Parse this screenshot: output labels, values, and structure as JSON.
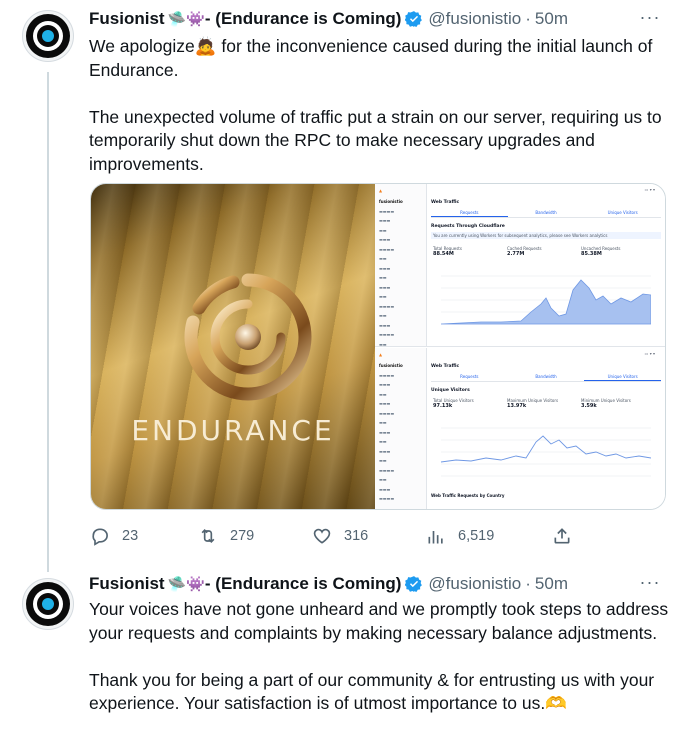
{
  "tweets": [
    {
      "name": "Fusionist",
      "emoji": "🛸👾",
      "name_suffix": " - (Endurance is Coming)",
      "handle": "@fusionistio",
      "time": "50m",
      "text": "We apologize🙇 for the inconvenience caused during the initial launch of Endurance.\n\nThe unexpected volume of traffic put a strain on our server, requiring us to temporarily shut down the RPC to make necessary upgrades and improvements.",
      "media": {
        "left_caption": "ENDURANCE",
        "dashboard": {
          "sidebar_title": "fusionistio",
          "title": "Web Traffic",
          "tabs": [
            "Requests",
            "Bandwidth",
            "Unique Visitors"
          ],
          "section_title": "Requests Through Cloudflare",
          "notice": "You are currently using Workers for subsequent analytics, please see Workers analytics",
          "stats": [
            {
              "label": "Total Requests",
              "value": "88.54M"
            },
            {
              "label": "Cached Requests",
              "value": "2.77M"
            },
            {
              "label": "Uncached Requests",
              "value": "85.38M"
            }
          ],
          "section_title_2": "Unique Visitors",
          "stats_2": [
            {
              "label": "Total Unique Visitors",
              "value": "97.13k"
            },
            {
              "label": "Maximum Unique Visitors",
              "value": "13.97k"
            },
            {
              "label": "Minimum Unique Visitors",
              "value": "3.59k"
            }
          ],
          "footer_title": "Web Traffic Requests by Country"
        }
      },
      "actions": {
        "replies": "23",
        "reposts": "279",
        "likes": "316",
        "views": "6,519"
      }
    },
    {
      "name": "Fusionist",
      "emoji": "🛸👾",
      "name_suffix": " - (Endurance is Coming)",
      "handle": "@fusionistio",
      "time": "50m",
      "text": "Your voices have not gone unheard and we promptly took steps to address your requests and complaints by making necessary balance adjustments.\n\nThank you for being a part of our community & for entrusting us with your experience. Your satisfaction is of utmost importance to us.🫶"
    }
  ],
  "colors": {
    "verified": "#1d9bf0",
    "secondary_text": "#536471",
    "thread_line": "#cfd9de"
  }
}
